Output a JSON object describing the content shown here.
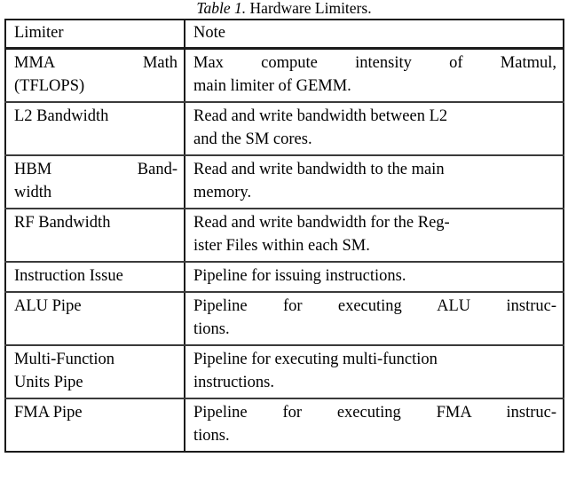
{
  "caption": {
    "number": "Table 1.",
    "title": "Hardware Limiters."
  },
  "table": {
    "columns": [
      "Limiter",
      "Note"
    ],
    "rows": [
      {
        "limiter": "MMA Math (TFLOPS)",
        "limiter_line1": "MMA      Math",
        "limiter_line2": "(TFLOPS)",
        "note": "Max compute intensity of Matmul, main limiter of GEMM.",
        "note_line1": "Max  compute  intensity  of  Matmul,",
        "note_line2": "main limiter of GEMM."
      },
      {
        "limiter": "L2 Bandwidth",
        "limiter_line1": "L2 Bandwidth",
        "limiter_line2": "",
        "note": "Read and write bandwidth between L2 and the SM cores.",
        "note_line1": "Read and write bandwidth between L2",
        "note_line2": "and the SM cores."
      },
      {
        "limiter": "HBM Bandwidth",
        "limiter_line1": "HBM      Band-",
        "limiter_line2": "width",
        "note": "Read and write bandwidth to the main memory.",
        "note_line1": "Read and write bandwidth to the main",
        "note_line2": "memory."
      },
      {
        "limiter": "RF Bandwidth",
        "limiter_line1": "RF Bandwidth",
        "limiter_line2": "",
        "note": "Read and write bandwidth for the Register Files within each SM.",
        "note_line1": "Read and write bandwidth for the Reg-",
        "note_line2": "ister Files within each SM."
      },
      {
        "limiter": "Instruction Issue",
        "limiter_line1": "Instruction Issue",
        "limiter_line2": "",
        "note": "Pipeline for issuing instructions.",
        "note_line1": "Pipeline for issuing instructions.",
        "note_line2": ""
      },
      {
        "limiter": "ALU Pipe",
        "limiter_line1": "ALU Pipe",
        "limiter_line2": "",
        "note": "Pipeline for executing ALU instructions.",
        "note_line1": "Pipeline  for  executing  ALU  instruc-",
        "note_line2": "tions."
      },
      {
        "limiter": "Multi-Function Units Pipe",
        "limiter_line1": "Multi-Function",
        "limiter_line2": "Units Pipe",
        "note": "Pipeline for executing multi-function instructions.",
        "note_line1": "Pipeline for executing multi-function",
        "note_line2": "instructions."
      },
      {
        "limiter": "FMA Pipe",
        "limiter_line1": "FMA Pipe",
        "limiter_line2": "",
        "note": "Pipeline for executing FMA instructions.",
        "note_line1": "Pipeline  for  executing  FMA  instruc-",
        "note_line2": "tions."
      }
    ]
  }
}
